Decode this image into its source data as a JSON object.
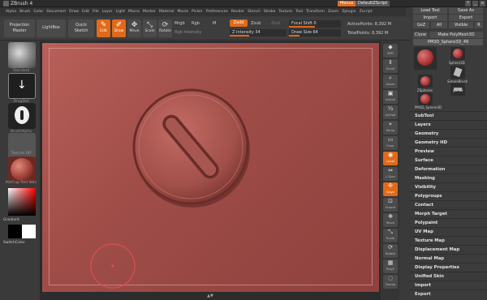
{
  "app": {
    "title": "ZBrush 4",
    "menus_button": "Menus",
    "default_script": "DefaultZScript",
    "window_controls": [
      "?",
      "_",
      "x"
    ]
  },
  "menubar": [
    "Alpha",
    "Brush",
    "Color",
    "Document",
    "Draw",
    "Edit",
    "File",
    "Layer",
    "Light",
    "Macro",
    "Marker",
    "Material",
    "Movie",
    "Picker",
    "Preferences",
    "Render",
    "Stencil",
    "Stroke",
    "Texture",
    "Tool",
    "Transform",
    "Zoom",
    "Zplugin",
    "Zscript"
  ],
  "toolbar": {
    "projection_master": "Projection Master",
    "lightbox": "LightBox",
    "quick_sketch": "Quick Sketch",
    "edit": "Edit",
    "draw": "Draw",
    "move": "Move",
    "scale": "Scale",
    "rotate": "Rotate",
    "mrgb": "Mrgb",
    "rgb": "Rgb",
    "m": "M",
    "rgb_intensity": "Rgb Intensity",
    "zadd": "Zadd",
    "zsub": "Zsub",
    "zcut": "Zcut",
    "z_intensity": "Z Intensity 34",
    "focal_shift": "Focal Shift 0",
    "draw_size": "Draw Size 64",
    "active_points": "ActivePoints: 8,392 M",
    "total_points": "TotalPoints: 8,392 M"
  },
  "tool_panel_top": {
    "load_tool": "Load Tool",
    "save_as": "Save As",
    "import": "Import",
    "export": "Export",
    "goz": "GoZ",
    "all": "All",
    "visible": "Visible",
    "r": "R",
    "clone": "Clone",
    "make_polymesh": "Make PolyMesh3D",
    "current_tool": "PM3D_Sphere3D_49",
    "tools": [
      {
        "label": "Sphere3D"
      },
      {
        "label": "SimpleBrush"
      },
      {
        "label": "ZSpheres"
      },
      {
        "label": "gun82"
      },
      {
        "label": "PM3D_Sphere3D"
      }
    ]
  },
  "tool_sections": [
    "SubTool",
    "Layers",
    "Geometry",
    "Geometry HD",
    "Preview",
    "Surface",
    "Deformation",
    "Masking",
    "Visibility",
    "Polygroups",
    "Contact",
    "Morph Target",
    "Polypaint",
    "UV Map",
    "Texture Map",
    "Displacement Map",
    "Normal Map",
    "Display Properties",
    "Unified Skin",
    "Import",
    "Export"
  ],
  "left_shelf": {
    "standard": "Standard",
    "dots": "DragDot",
    "alpha": "Alpha 00",
    "brush_alpha": "BrushAlpha",
    "texture_off": "Texture Off",
    "material": "MatCap Red Wax",
    "gradient": "Gradient",
    "switch_color": "SwitchColor"
  },
  "right_strip": [
    "BPR",
    "Scroll",
    "Zoom",
    "Actual",
    "AAHalf",
    "Persp",
    "Floor",
    "Local",
    "L.Sym",
    "Gxyz",
    "Frame",
    "Move",
    "Scale",
    "Rotate",
    "PolyF",
    "Transp"
  ],
  "colors": {
    "accent": "#e06a1a",
    "canvas": "#a8534d"
  }
}
